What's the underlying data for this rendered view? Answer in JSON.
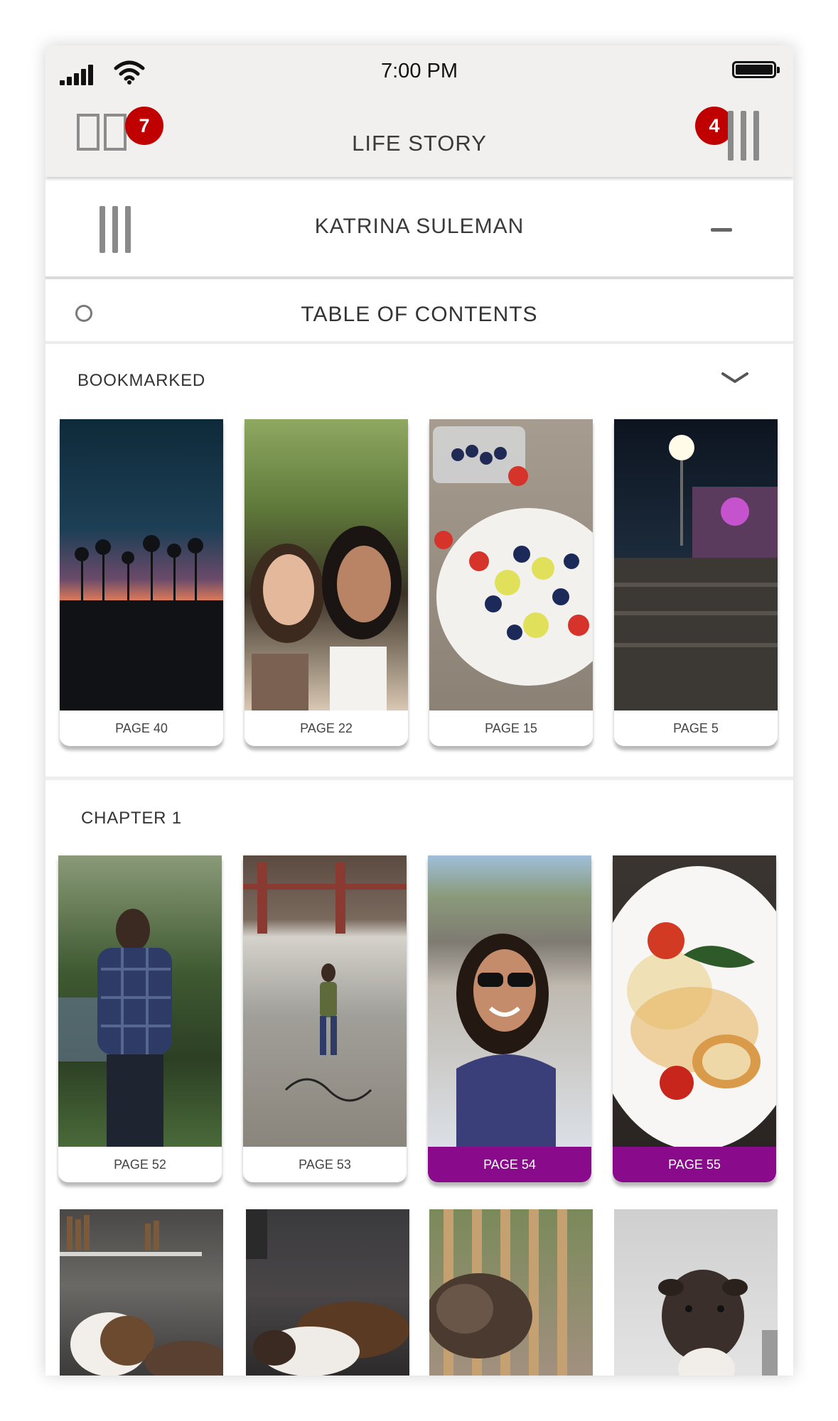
{
  "status_bar": {
    "time": "7:00 PM"
  },
  "header": {
    "title": "LIFE STORY",
    "left_badge": "7",
    "right_badge": "4"
  },
  "person": {
    "name": "KATRINA SULEMAN"
  },
  "toc": {
    "title": "TABLE OF CONTENTS"
  },
  "colors": {
    "accent": "#8a0a8c",
    "badge": "#c00000",
    "topbar": "#f2f0ee"
  },
  "bookmarked": {
    "label": "BOOKMARKED",
    "items": [
      {
        "caption": "PAGE 40",
        "image": "sunset palm trees silhouette"
      },
      {
        "caption": "PAGE 22",
        "image": "two women selfie"
      },
      {
        "caption": "PAGE 15",
        "image": "fruit bowl with blueberries"
      },
      {
        "caption": "PAGE 5",
        "image": "stadium concert crowd at night"
      }
    ]
  },
  "chapter1": {
    "label": "CHAPTER 1",
    "items": [
      {
        "caption": "PAGE 52",
        "image": "man in plaid shirt by water"
      },
      {
        "caption": "PAGE 53",
        "image": "woman standing under bridge"
      },
      {
        "caption": "PAGE 54",
        "image": "woman selfie with sunglasses"
      },
      {
        "caption": "PAGE 55",
        "image": "plate of scallops and tomatoes"
      }
    ],
    "more_items": [
      {
        "image": "dog on couch by bookshelf"
      },
      {
        "image": "dog sleeping on dark couch"
      },
      {
        "image": "dog resting on wooden deck"
      },
      {
        "image": "dog against white wall"
      }
    ]
  }
}
